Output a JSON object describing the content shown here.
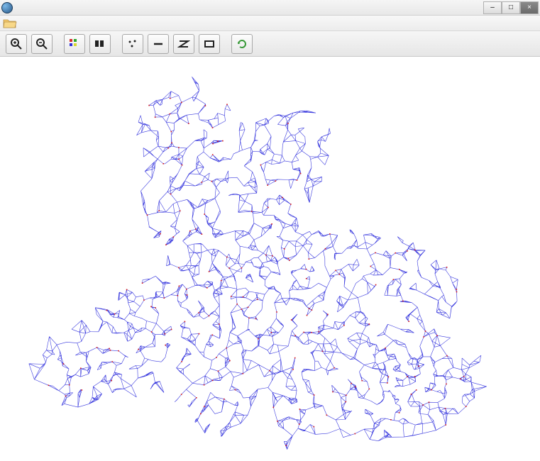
{
  "window": {
    "title": "",
    "app_icon": "globe-icon"
  },
  "window_controls": {
    "minimize": "–",
    "maximize": "□",
    "close": "×"
  },
  "menubar": {
    "open_file": "open-folder-icon"
  },
  "toolbar": {
    "zoom_in": "zoom-in-icon",
    "zoom_out": "zoom-out-icon",
    "color_grid": "color-layers-icon",
    "bw_grid": "bw-layers-icon",
    "scatter_points": "points-icon",
    "line_tool": "line-icon",
    "zigzag_tool": "zigzag-icon",
    "rect_tool": "rectangle-icon",
    "refresh": "refresh-icon"
  },
  "canvas": {
    "content_type": "road-network-map",
    "primary_color": "#1818d8",
    "node_color": "#d81818",
    "background": "#ffffff"
  }
}
